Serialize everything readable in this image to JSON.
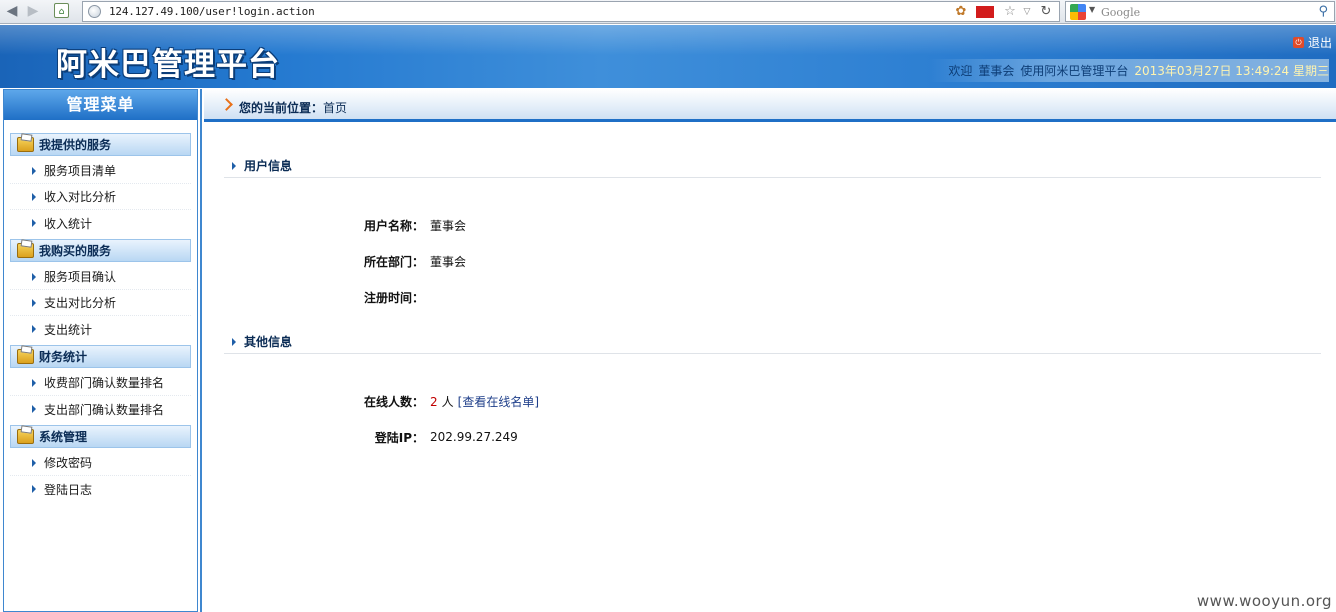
{
  "browser": {
    "url": "124.127.49.100/user!login.action",
    "search_placeholder": "Google"
  },
  "header": {
    "app_title": "阿米巴管理平台",
    "logout_label": "退出",
    "welcome_prefix": "欢迎",
    "username": "董事会",
    "welcome_suffix": "使用阿米巴管理平台",
    "datetime": "2013年03月27日 13:49:24 星期三"
  },
  "sidebar": {
    "title": "管理菜单",
    "groups": [
      {
        "title": "我提供的服务",
        "items": [
          "服务项目清单",
          "收入对比分析",
          "收入统计"
        ]
      },
      {
        "title": "我购买的服务",
        "items": [
          "服务项目确认",
          "支出对比分析",
          "支出统计"
        ]
      },
      {
        "title": "财务统计",
        "items": [
          "收费部门确认数量排名",
          "支出部门确认数量排名"
        ]
      },
      {
        "title": "系统管理",
        "items": [
          "修改密码",
          "登陆日志"
        ]
      }
    ]
  },
  "breadcrumb": {
    "label": "您的当前位置：",
    "current": "首页"
  },
  "user_info": {
    "section_title": "用户信息",
    "name_label": "用户名称：",
    "name_value": "董事会",
    "dept_label": "所在部门：",
    "dept_value": "董事会",
    "reg_label": "注册时间：",
    "reg_value": ""
  },
  "other_info": {
    "section_title": "其他信息",
    "online_label": "在线人数：",
    "online_count": "2",
    "online_unit": "人",
    "online_link": "[查看在线名单]",
    "ip_label": "登陆IP：",
    "ip_value": "202.99.27.249"
  },
  "watermark": "www.wooyun.org"
}
